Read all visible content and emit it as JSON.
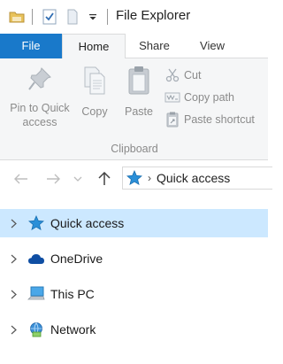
{
  "window": {
    "title": "File Explorer",
    "quick_access_toolbar": [
      "folder-icon",
      "properties-check-icon",
      "new-folder-icon",
      "customize-dropdown-icon"
    ]
  },
  "tabs": [
    {
      "label": "File",
      "active": false,
      "accent": "#1979ca"
    },
    {
      "label": "Home",
      "active": true
    },
    {
      "label": "Share",
      "active": false
    },
    {
      "label": "View",
      "active": false
    }
  ],
  "ribbon": {
    "group_label": "Clipboard",
    "pin_label_line1": "Pin to Quick",
    "pin_label_line2": "access",
    "copy_label": "Copy",
    "paste_label": "Paste",
    "cut_label": "Cut",
    "copy_path_label": "Copy path",
    "paste_shortcut_label": "Paste shortcut",
    "disabled_text_color": "#8a8a8a"
  },
  "navigation": {
    "back_icon": "arrow-left-icon",
    "forward_icon": "arrow-right-icon",
    "recent_icon": "chevron-down-icon",
    "up_icon": "arrow-up-icon",
    "address_path": "Quick access"
  },
  "tree": {
    "selected_color": "#cce8ff",
    "items": [
      {
        "label": "Quick access",
        "icon": "star-icon",
        "selected": true
      },
      {
        "label": "OneDrive",
        "icon": "cloud-icon",
        "selected": false
      },
      {
        "label": "This PC",
        "icon": "computer-icon",
        "selected": false
      },
      {
        "label": "Network",
        "icon": "network-icon",
        "selected": false
      }
    ]
  }
}
